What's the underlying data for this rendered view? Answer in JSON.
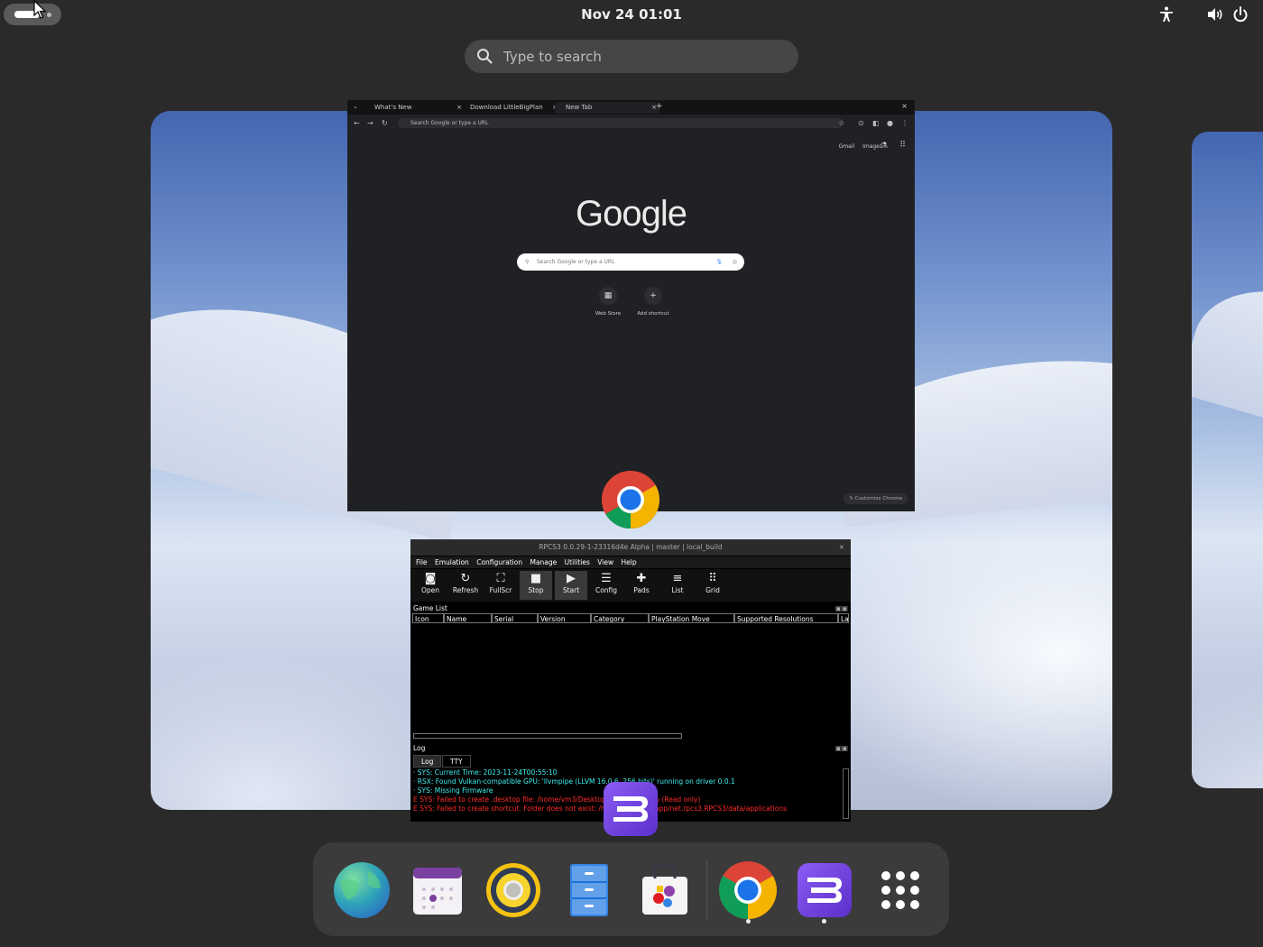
{
  "topbar": {
    "clock": "Nov 24  01:01"
  },
  "search": {
    "placeholder": "Type to search"
  },
  "chrome_window": {
    "tabs": [
      "What's New",
      "Download LittleBigPlan",
      "New Tab"
    ],
    "address_placeholder": "Search Google or type a URL",
    "top_links": [
      "Gmail",
      "Images"
    ],
    "logo": "Google",
    "search_placeholder": "Search Google or type a URL",
    "shortcuts": [
      "Web Store",
      "Add shortcut"
    ],
    "customize": "Customize Chrome"
  },
  "rpcs3_window": {
    "title": "RPCS3 0.0.29-1-23316d4e Alpha | master | local_build",
    "menu": [
      "File",
      "Emulation",
      "Configuration",
      "Manage",
      "Utilities",
      "View",
      "Help"
    ],
    "toolbar": [
      "Open",
      "Refresh",
      "FullScr",
      "Stop",
      "Start",
      "Config",
      "Pads",
      "List",
      "Grid"
    ],
    "game_list_label": "Game List",
    "columns": [
      "Icon",
      "Name",
      "Serial",
      "Version",
      "Category",
      "PlayStation Move",
      "Supported Resolutions",
      "Las"
    ],
    "log_label": "Log",
    "log_tabs": [
      "Log",
      "TTY"
    ],
    "log_lines": [
      "· SYS: Current Time: 2023-11-24T00:55:10",
      "· RSX: Found Vulkan-compatible GPU: 'llvmpipe (LLVM 16.0.6, 256 bits)' running on driver 0.0.1",
      "· SYS: Missing Firmware",
      "E SYS: Failed to create .desktop file: /home/vm3/Desktop/RPCS3.desktop (Read only)",
      "E SYS: Failed to create shortcut. Folder does not exist: /home/vm3/.var/app/net.rpcs3.RPCS3/data/applications"
    ]
  },
  "dock": {
    "apps": [
      "Web",
      "Calendar",
      "Rhythmbox",
      "Files",
      "Software",
      "Google Chrome",
      "RPCS3",
      "Show Apps"
    ]
  }
}
